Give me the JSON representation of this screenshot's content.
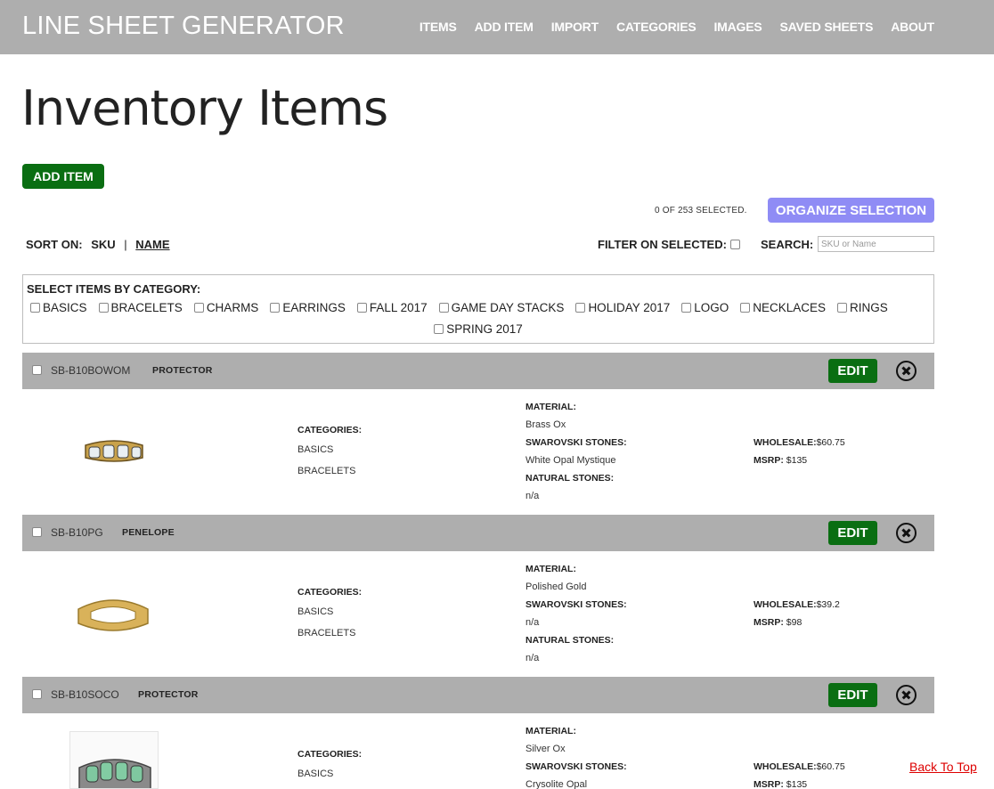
{
  "app": {
    "title": "LINE SHEET GENERATOR",
    "nav": [
      "ITEMS",
      "ADD ITEM",
      "IMPORT",
      "CATEGORIES",
      "IMAGES",
      "SAVED SHEETS",
      "ABOUT"
    ]
  },
  "page": {
    "title": "Inventory Items",
    "add_button": "ADD ITEM",
    "selected_count": "0 OF 253 SELECTED.",
    "organize_button": "ORGANIZE SELECTION"
  },
  "sort": {
    "label": "SORT ON:",
    "sku": "SKU",
    "separator": "|",
    "name": "NAME"
  },
  "filter": {
    "label": "FILTER ON SELECTED:"
  },
  "search": {
    "label": "SEARCH:",
    "placeholder": "SKU or Name",
    "value": ""
  },
  "categories": {
    "title": "SELECT ITEMS BY CATEGORY:",
    "row1": [
      "BASICS",
      "BRACELETS",
      "CHARMS",
      "EARRINGS",
      "FALL 2017",
      "GAME DAY STACKS",
      "HOLIDAY 2017",
      "LOGO",
      "NECKLACES",
      "RINGS"
    ],
    "row2": [
      "SPRING 2017"
    ]
  },
  "item_labels": {
    "edit": "EDIT",
    "categories": "CATEGORIES:",
    "material": "MATERIAL:",
    "swarovski": "SWAROVSKI STONES:",
    "natural": "NATURAL STONES:",
    "wholesale": "WHOLESALE:",
    "msrp": "MSRP:"
  },
  "items": [
    {
      "sku": "SB-B10BOWOM",
      "name": "PROTECTOR",
      "categories": [
        "BASICS",
        "BRACELETS"
      ],
      "material": "Brass Ox",
      "swarovski": "White Opal Mystique",
      "natural": "n/a",
      "wholesale": "$60.75",
      "msrp": "$135"
    },
    {
      "sku": "SB-B10PG",
      "name": "PENELOPE",
      "categories": [
        "BASICS",
        "BRACELETS"
      ],
      "material": "Polished Gold",
      "swarovski": "n/a",
      "natural": "n/a",
      "wholesale": "$39.2",
      "msrp": "$98"
    },
    {
      "sku": "SB-B10SOCO",
      "name": "PROTECTOR",
      "categories": [
        "BASICS"
      ],
      "material": "Silver Ox",
      "swarovski": "Crysolite Opal",
      "natural": "",
      "wholesale": "$60.75",
      "msrp": "$135"
    }
  ],
  "back_to_top": "Back To Top",
  "colors": {
    "header": "#aeaeae",
    "edit": "#0a6e12",
    "organize": "#8f8cf5",
    "back_to_top": "#dd0000"
  }
}
